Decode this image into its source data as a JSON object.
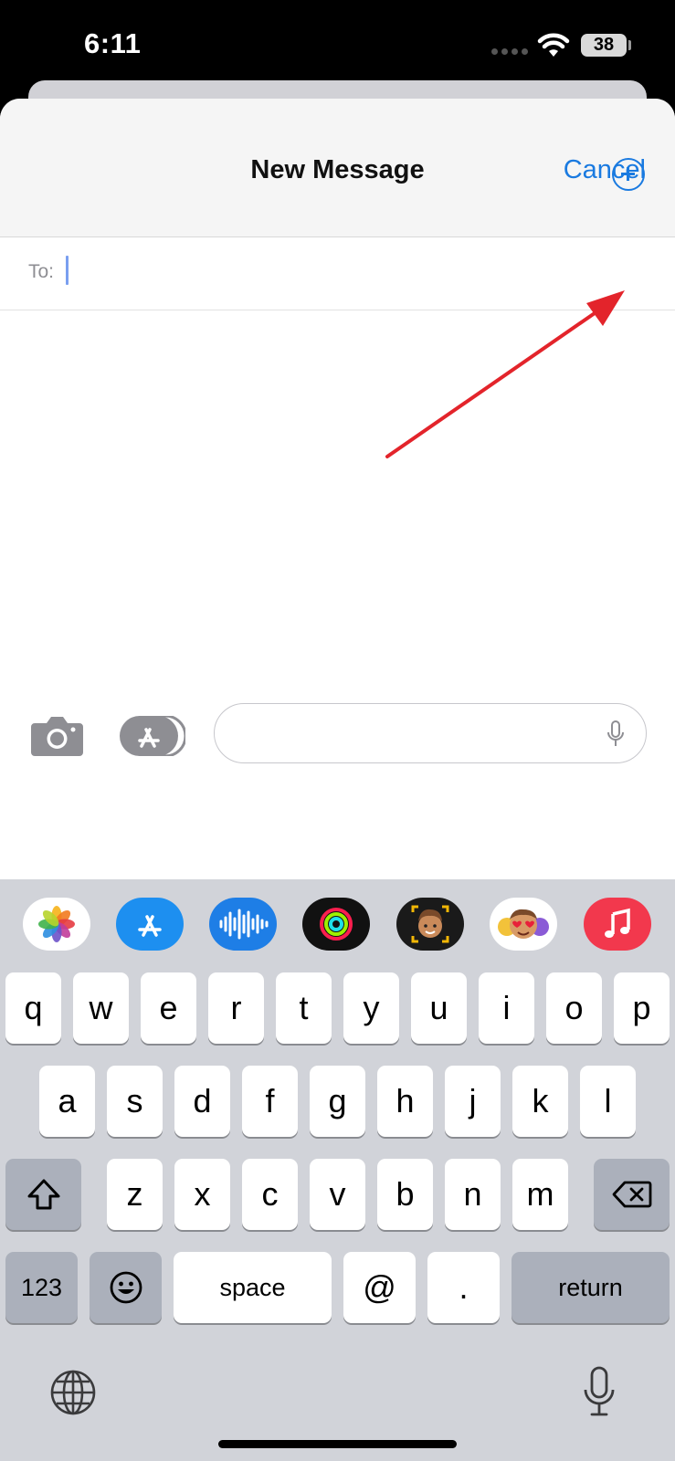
{
  "status_bar": {
    "time": "6:11",
    "battery": "38"
  },
  "nav": {
    "title": "New Message",
    "cancel_label": "Cancel"
  },
  "to_field": {
    "label": "To:",
    "value": ""
  },
  "compose": {
    "message_value": ""
  },
  "app_strip": [
    {
      "name": "photos-app-icon"
    },
    {
      "name": "app-store-icon"
    },
    {
      "name": "audio-message-icon"
    },
    {
      "name": "activity-icon"
    },
    {
      "name": "memoji-icon"
    },
    {
      "name": "memoji-stickers-icon"
    },
    {
      "name": "music-icon"
    }
  ],
  "keyboard": {
    "row1": [
      "q",
      "w",
      "e",
      "r",
      "t",
      "y",
      "u",
      "i",
      "o",
      "p"
    ],
    "row2": [
      "a",
      "s",
      "d",
      "f",
      "g",
      "h",
      "j",
      "k",
      "l"
    ],
    "row3": [
      "z",
      "x",
      "c",
      "v",
      "b",
      "n",
      "m"
    ],
    "numbers_label": "123",
    "space_label": "space",
    "at_label": "@",
    "period_label": ".",
    "return_label": "return"
  },
  "colors": {
    "accent": "#1a7ae0",
    "annotation_arrow": "#e3242b"
  }
}
